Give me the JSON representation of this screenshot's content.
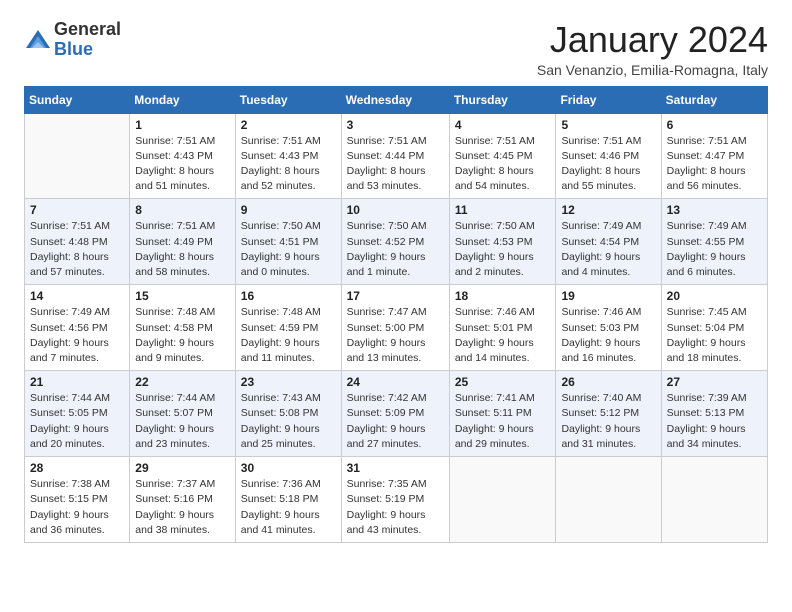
{
  "logo": {
    "general": "General",
    "blue": "Blue"
  },
  "header": {
    "month": "January 2024",
    "location": "San Venanzio, Emilia-Romagna, Italy"
  },
  "weekdays": [
    "Sunday",
    "Monday",
    "Tuesday",
    "Wednesday",
    "Thursday",
    "Friday",
    "Saturday"
  ],
  "weeks": [
    [
      {
        "day": "",
        "sunrise": "",
        "sunset": "",
        "daylight": ""
      },
      {
        "day": "1",
        "sunrise": "Sunrise: 7:51 AM",
        "sunset": "Sunset: 4:43 PM",
        "daylight": "Daylight: 8 hours and 51 minutes."
      },
      {
        "day": "2",
        "sunrise": "Sunrise: 7:51 AM",
        "sunset": "Sunset: 4:43 PM",
        "daylight": "Daylight: 8 hours and 52 minutes."
      },
      {
        "day": "3",
        "sunrise": "Sunrise: 7:51 AM",
        "sunset": "Sunset: 4:44 PM",
        "daylight": "Daylight: 8 hours and 53 minutes."
      },
      {
        "day": "4",
        "sunrise": "Sunrise: 7:51 AM",
        "sunset": "Sunset: 4:45 PM",
        "daylight": "Daylight: 8 hours and 54 minutes."
      },
      {
        "day": "5",
        "sunrise": "Sunrise: 7:51 AM",
        "sunset": "Sunset: 4:46 PM",
        "daylight": "Daylight: 8 hours and 55 minutes."
      },
      {
        "day": "6",
        "sunrise": "Sunrise: 7:51 AM",
        "sunset": "Sunset: 4:47 PM",
        "daylight": "Daylight: 8 hours and 56 minutes."
      }
    ],
    [
      {
        "day": "7",
        "sunrise": "Sunrise: 7:51 AM",
        "sunset": "Sunset: 4:48 PM",
        "daylight": "Daylight: 8 hours and 57 minutes."
      },
      {
        "day": "8",
        "sunrise": "Sunrise: 7:51 AM",
        "sunset": "Sunset: 4:49 PM",
        "daylight": "Daylight: 8 hours and 58 minutes."
      },
      {
        "day": "9",
        "sunrise": "Sunrise: 7:50 AM",
        "sunset": "Sunset: 4:51 PM",
        "daylight": "Daylight: 9 hours and 0 minutes."
      },
      {
        "day": "10",
        "sunrise": "Sunrise: 7:50 AM",
        "sunset": "Sunset: 4:52 PM",
        "daylight": "Daylight: 9 hours and 1 minute."
      },
      {
        "day": "11",
        "sunrise": "Sunrise: 7:50 AM",
        "sunset": "Sunset: 4:53 PM",
        "daylight": "Daylight: 9 hours and 2 minutes."
      },
      {
        "day": "12",
        "sunrise": "Sunrise: 7:49 AM",
        "sunset": "Sunset: 4:54 PM",
        "daylight": "Daylight: 9 hours and 4 minutes."
      },
      {
        "day": "13",
        "sunrise": "Sunrise: 7:49 AM",
        "sunset": "Sunset: 4:55 PM",
        "daylight": "Daylight: 9 hours and 6 minutes."
      }
    ],
    [
      {
        "day": "14",
        "sunrise": "Sunrise: 7:49 AM",
        "sunset": "Sunset: 4:56 PM",
        "daylight": "Daylight: 9 hours and 7 minutes."
      },
      {
        "day": "15",
        "sunrise": "Sunrise: 7:48 AM",
        "sunset": "Sunset: 4:58 PM",
        "daylight": "Daylight: 9 hours and 9 minutes."
      },
      {
        "day": "16",
        "sunrise": "Sunrise: 7:48 AM",
        "sunset": "Sunset: 4:59 PM",
        "daylight": "Daylight: 9 hours and 11 minutes."
      },
      {
        "day": "17",
        "sunrise": "Sunrise: 7:47 AM",
        "sunset": "Sunset: 5:00 PM",
        "daylight": "Daylight: 9 hours and 13 minutes."
      },
      {
        "day": "18",
        "sunrise": "Sunrise: 7:46 AM",
        "sunset": "Sunset: 5:01 PM",
        "daylight": "Daylight: 9 hours and 14 minutes."
      },
      {
        "day": "19",
        "sunrise": "Sunrise: 7:46 AM",
        "sunset": "Sunset: 5:03 PM",
        "daylight": "Daylight: 9 hours and 16 minutes."
      },
      {
        "day": "20",
        "sunrise": "Sunrise: 7:45 AM",
        "sunset": "Sunset: 5:04 PM",
        "daylight": "Daylight: 9 hours and 18 minutes."
      }
    ],
    [
      {
        "day": "21",
        "sunrise": "Sunrise: 7:44 AM",
        "sunset": "Sunset: 5:05 PM",
        "daylight": "Daylight: 9 hours and 20 minutes."
      },
      {
        "day": "22",
        "sunrise": "Sunrise: 7:44 AM",
        "sunset": "Sunset: 5:07 PM",
        "daylight": "Daylight: 9 hours and 23 minutes."
      },
      {
        "day": "23",
        "sunrise": "Sunrise: 7:43 AM",
        "sunset": "Sunset: 5:08 PM",
        "daylight": "Daylight: 9 hours and 25 minutes."
      },
      {
        "day": "24",
        "sunrise": "Sunrise: 7:42 AM",
        "sunset": "Sunset: 5:09 PM",
        "daylight": "Daylight: 9 hours and 27 minutes."
      },
      {
        "day": "25",
        "sunrise": "Sunrise: 7:41 AM",
        "sunset": "Sunset: 5:11 PM",
        "daylight": "Daylight: 9 hours and 29 minutes."
      },
      {
        "day": "26",
        "sunrise": "Sunrise: 7:40 AM",
        "sunset": "Sunset: 5:12 PM",
        "daylight": "Daylight: 9 hours and 31 minutes."
      },
      {
        "day": "27",
        "sunrise": "Sunrise: 7:39 AM",
        "sunset": "Sunset: 5:13 PM",
        "daylight": "Daylight: 9 hours and 34 minutes."
      }
    ],
    [
      {
        "day": "28",
        "sunrise": "Sunrise: 7:38 AM",
        "sunset": "Sunset: 5:15 PM",
        "daylight": "Daylight: 9 hours and 36 minutes."
      },
      {
        "day": "29",
        "sunrise": "Sunrise: 7:37 AM",
        "sunset": "Sunset: 5:16 PM",
        "daylight": "Daylight: 9 hours and 38 minutes."
      },
      {
        "day": "30",
        "sunrise": "Sunrise: 7:36 AM",
        "sunset": "Sunset: 5:18 PM",
        "daylight": "Daylight: 9 hours and 41 minutes."
      },
      {
        "day": "31",
        "sunrise": "Sunrise: 7:35 AM",
        "sunset": "Sunset: 5:19 PM",
        "daylight": "Daylight: 9 hours and 43 minutes."
      },
      {
        "day": "",
        "sunrise": "",
        "sunset": "",
        "daylight": ""
      },
      {
        "day": "",
        "sunrise": "",
        "sunset": "",
        "daylight": ""
      },
      {
        "day": "",
        "sunrise": "",
        "sunset": "",
        "daylight": ""
      }
    ]
  ]
}
